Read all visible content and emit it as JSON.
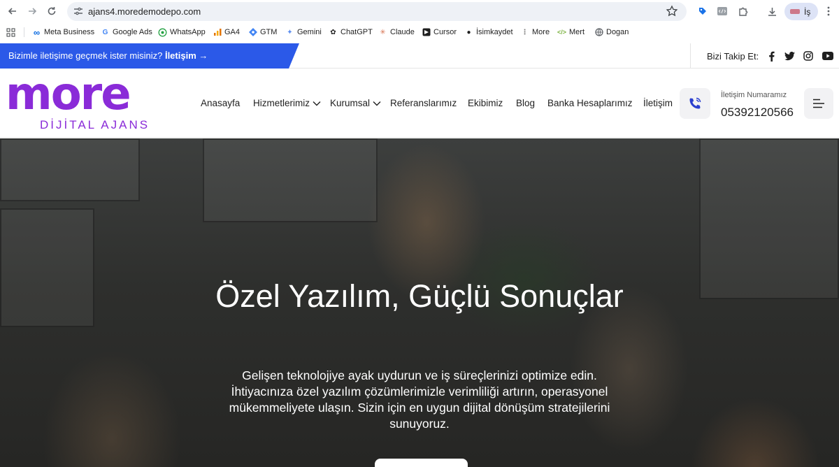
{
  "browser": {
    "url": "ajans4.moredemodepo.com",
    "profile_name": "İş",
    "icons": {
      "back": "arrow-left-icon",
      "forward": "arrow-right-icon",
      "reload": "reload-icon",
      "site_info": "tune-icon",
      "bookmark": "star-icon",
      "extensions": "puzzle-icon",
      "download": "download-icon",
      "menu": "kebab-menu-icon"
    }
  },
  "bookmarks": [
    {
      "label": "Meta Business",
      "icon": "meta-icon"
    },
    {
      "label": "Google Ads",
      "icon": "google-icon"
    },
    {
      "label": "WhatsApp",
      "icon": "whatsapp-icon"
    },
    {
      "label": "GA4",
      "icon": "analytics-icon"
    },
    {
      "label": "GTM",
      "icon": "gtm-icon"
    },
    {
      "label": "Gemini",
      "icon": "gemini-icon"
    },
    {
      "label": "ChatGPT",
      "icon": "chatgpt-icon"
    },
    {
      "label": "Claude",
      "icon": "claude-icon"
    },
    {
      "label": "Cursor",
      "icon": "cursor-icon"
    },
    {
      "label": "İsimkaydet",
      "icon": "isimkaydet-icon"
    },
    {
      "label": "More",
      "icon": "dots-icon"
    },
    {
      "label": "Mert",
      "icon": "code-icon"
    },
    {
      "label": "Dogan",
      "icon": "globe-icon"
    }
  ],
  "topbar": {
    "prompt": "Bizimle iletişime geçmek ister misiniz?",
    "contact_link": "İletişim",
    "follow_label": "Bizi Takip Et:",
    "socials": [
      "facebook-icon",
      "twitter-icon",
      "instagram-icon",
      "youtube-icon"
    ]
  },
  "header": {
    "logo_word": "more",
    "logo_sub": "DİJİTAL AJANS",
    "nav": [
      {
        "label": "Anasayfa",
        "dropdown": false
      },
      {
        "label": "Hizmetlerimiz",
        "dropdown": true
      },
      {
        "label": "Kurumsal",
        "dropdown": true
      },
      {
        "label": "Referanslarımız",
        "dropdown": false
      },
      {
        "label": "Ekibimiz",
        "dropdown": false
      },
      {
        "label": "Blog",
        "dropdown": false
      },
      {
        "label": "Banka Hesaplarımız",
        "dropdown": false
      },
      {
        "label": "İletişim",
        "dropdown": false
      }
    ],
    "phone_label": "İletişim Numaramız",
    "phone_number": "05392120566"
  },
  "hero": {
    "title": "Özel Yazılım, Güçlü Sonuçlar",
    "text": "Gelişen teknolojiye ayak uydurun ve iş süreçlerinizi optimize edin. İhtiyacınıza özel yazılım çözümlerimizle verimliliği artırın, operasyonel mükemmeliyete ulaşın. Sizin için en uygun dijital dönüşüm stratejilerini sunuyoruz."
  },
  "colors": {
    "brand_purple": "#8a2bd8",
    "topbar_blue": "#2b59e8",
    "phone_icon_blue": "#2b3fcf"
  }
}
